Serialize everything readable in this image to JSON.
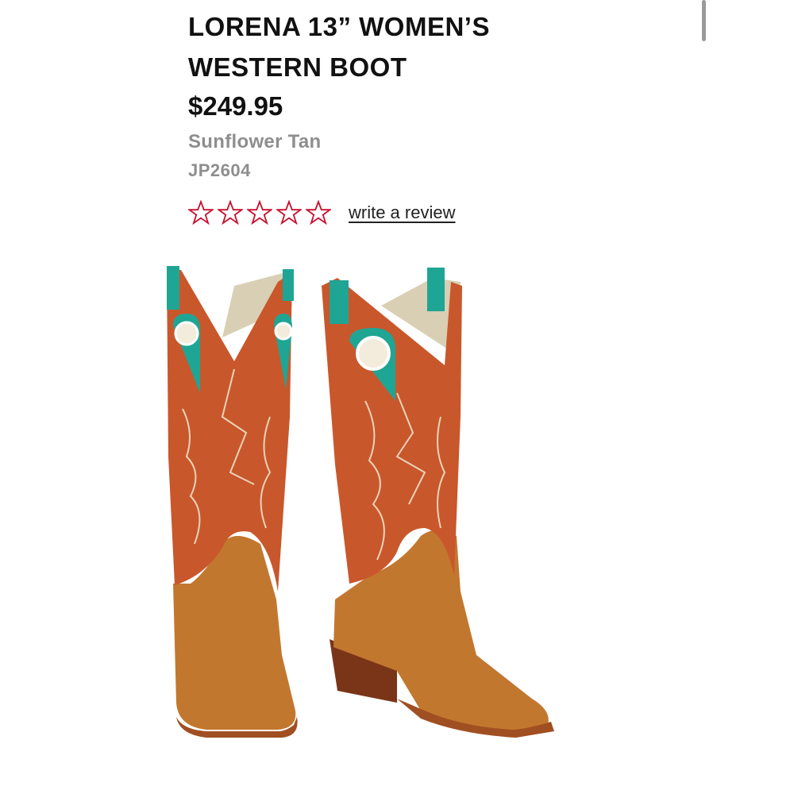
{
  "product": {
    "title": "LORENA 13” WOMEN’S WESTERN BOOT",
    "price": "$249.95",
    "color_name": "Sunflower Tan",
    "sku": "JP2604"
  },
  "rating": {
    "stars_filled": 0,
    "stars_total": 5,
    "star_color": "#c8102e",
    "write_review_label": "write a review"
  },
  "colors": {
    "boot_shaft": "#c9572c",
    "boot_foot": "#c2772f",
    "accent_teal": "#1fa594"
  }
}
